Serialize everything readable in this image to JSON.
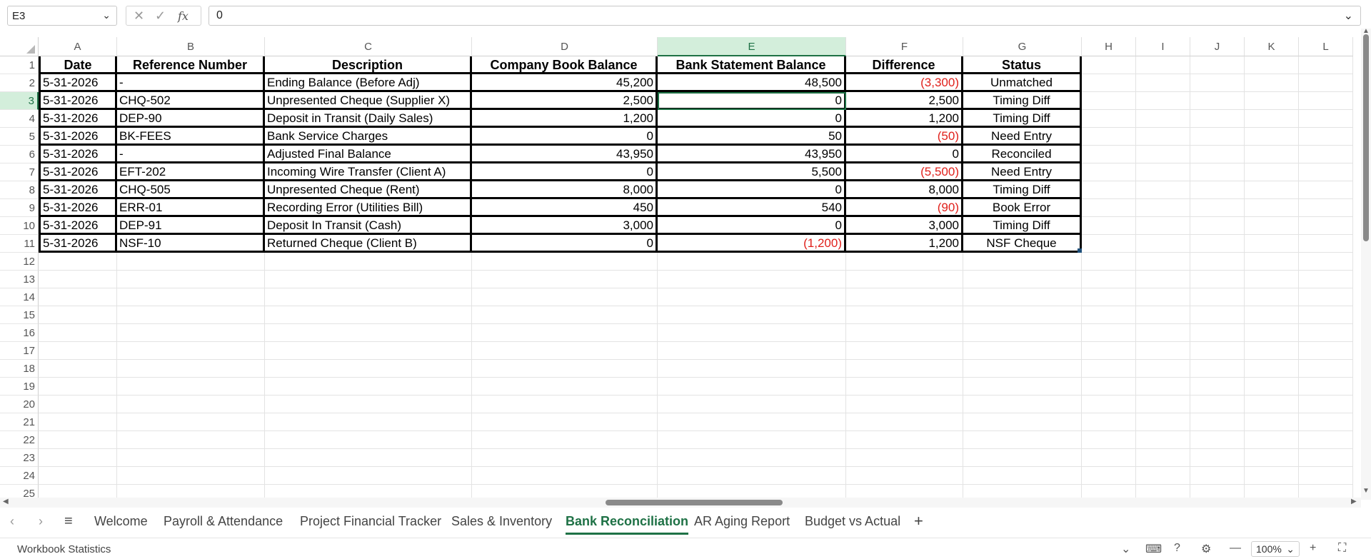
{
  "formula_bar": {
    "name_box": "E3",
    "cancel_icon": "✕",
    "confirm_icon": "✓",
    "fx_icon": "fx",
    "formula_value": "0"
  },
  "columns": [
    "A",
    "B",
    "C",
    "D",
    "E",
    "F",
    "G",
    "H",
    "I",
    "J",
    "K",
    "L"
  ],
  "rows": [
    "1",
    "2",
    "3",
    "4",
    "5",
    "6",
    "7",
    "8",
    "9",
    "10",
    "11",
    "12",
    "13",
    "14",
    "15",
    "16",
    "17",
    "18",
    "19",
    "20",
    "21",
    "22",
    "23",
    "24",
    "25"
  ],
  "selected_cell": "E3",
  "table": {
    "headers": [
      "Date",
      "Reference Number",
      "Description",
      "Company Book Balance",
      "Bank Statement Balance",
      "Difference",
      "Status"
    ],
    "rows": [
      [
        "5-31-2026",
        "-",
        "Ending Balance (Before Adj)",
        "45,200",
        "48,500",
        "(3,300)",
        "Unmatched"
      ],
      [
        "5-31-2026",
        "CHQ-502",
        "Unpresented Cheque (Supplier X)",
        "2,500",
        "0",
        "2,500",
        "Timing Diff"
      ],
      [
        "5-31-2026",
        "DEP-90",
        "Deposit in Transit (Daily Sales)",
        "1,200",
        "0",
        "1,200",
        "Timing Diff"
      ],
      [
        "5-31-2026",
        "BK-FEES",
        "Bank Service Charges",
        "0",
        "50",
        "(50)",
        "Need Entry"
      ],
      [
        "5-31-2026",
        "-",
        "Adjusted Final Balance",
        "43,950",
        "43,950",
        "0",
        "Reconciled"
      ],
      [
        "5-31-2026",
        "EFT-202",
        "Incoming Wire Transfer (Client A)",
        "0",
        "5,500",
        "(5,500)",
        "Need Entry"
      ],
      [
        "5-31-2026",
        "CHQ-505",
        "Unpresented Cheque (Rent)",
        "8,000",
        "0",
        "8,000",
        "Timing Diff"
      ],
      [
        "5-31-2026",
        "ERR-01",
        "Recording Error (Utilities Bill)",
        "450",
        "540",
        "(90)",
        "Book Error"
      ],
      [
        "5-31-2026",
        "DEP-91",
        "Deposit In Transit (Cash)",
        "3,000",
        "0",
        "3,000",
        "Timing Diff"
      ],
      [
        "5-31-2026",
        "NSF-10",
        "Returned Cheque (Client B)",
        "0",
        "(1,200)",
        "1,200",
        "NSF Cheque"
      ]
    ]
  },
  "sheet_tabs": {
    "tabs": [
      "Welcome",
      "Payroll & Attendance",
      "Project Financial Tracker",
      "Sales & Inventory",
      "Bank Reconciliation",
      "AR Aging Report",
      "Budget vs Actual"
    ],
    "active": "Bank Reconciliation",
    "add_label": "+"
  },
  "status_bar": {
    "left_text": "Workbook Statistics",
    "zoom": "100%"
  },
  "colors": {
    "accent": "#1e7145",
    "negative": "#e0201b",
    "selection_fill": "#d3eedb"
  }
}
